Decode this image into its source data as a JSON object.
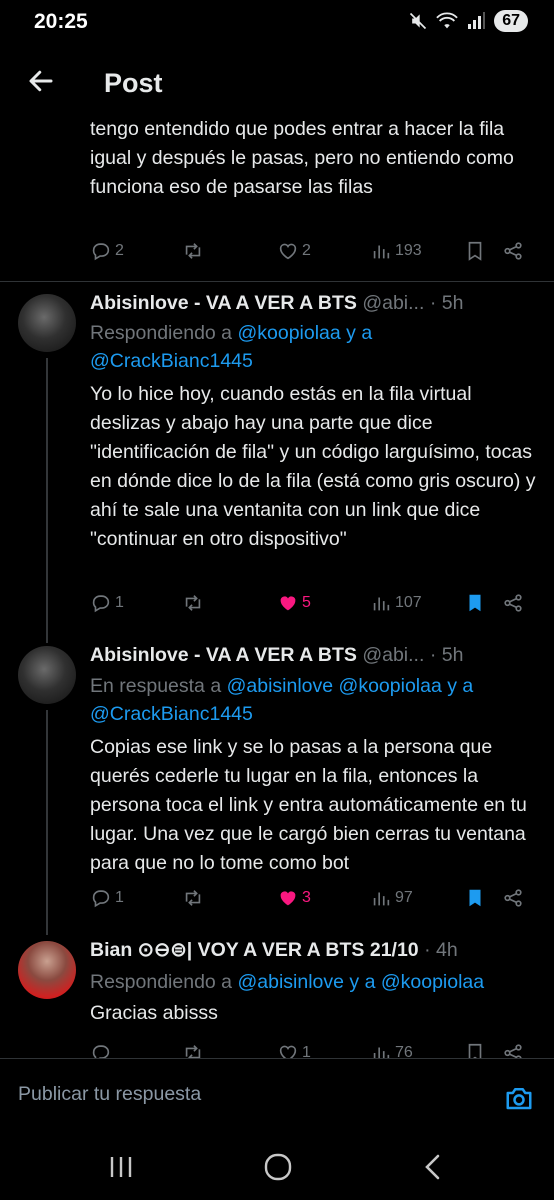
{
  "status": {
    "time": "20:25",
    "battery": "67"
  },
  "header": {
    "title": "Post"
  },
  "tweets": [
    {
      "text": "tengo entendido que podes entrar a hacer la fila igual y después le pasas, pero no entiendo como funciona eso de pasarse las filas",
      "replies": "2",
      "retweets": "",
      "likes": "2",
      "views": "193"
    },
    {
      "author": "Abisinlove - VA A VER A BTS",
      "handle": "@abi...",
      "time": "· 5h",
      "reply_prefix": "Respondiendo a",
      "reply_mentions": "@koopiolaa y a @CrackBianc1445",
      "text": "Yo lo hice hoy, cuando estás en la fila virtual deslizas y abajo hay una parte que dice \"identificación de fila\" y un código larguísimo, tocas en dónde dice lo de la fila (está como gris oscuro) y ahí te sale una ventanita con un link que dice \"continuar en otro dispositivo\"",
      "replies": "1",
      "likes": "5",
      "views": "107"
    },
    {
      "author": "Abisinlove - VA A VER A BTS",
      "handle": "@abi...",
      "time": "· 5h",
      "reply_prefix": "En respuesta a",
      "reply_mentions": "@abisinlove @koopiolaa y a @CrackBianc1445",
      "text": "Copias ese link y se lo pasas a la persona que querés cederle tu lugar en la fila, entonces la persona toca el link y entra automáticamente en tu lugar. Una vez que le cargó bien cerras tu ventana para que no lo tome como bot",
      "replies": "1",
      "likes": "3",
      "views": "97"
    },
    {
      "author": "Bian ⊙⊖⊜| VOY A VER A BTS 21/10",
      "time": "· 4h",
      "reply_prefix": "Respondiendo a",
      "reply_mentions": "@abisinlove y a @koopiolaa",
      "text": "Gracias abisss",
      "replies": "",
      "likes": "1",
      "views": "76"
    }
  ],
  "reply_bar": {
    "placeholder": "Publicar tu respuesta"
  },
  "colors": {
    "accent": "#1d9bf0",
    "like": "#f91880",
    "muted": "#71767b",
    "text": "#e7e9ea",
    "background": "#000000"
  }
}
